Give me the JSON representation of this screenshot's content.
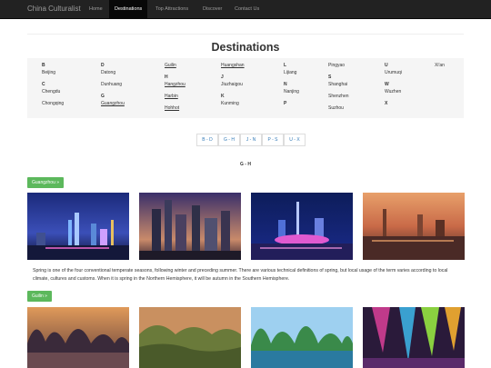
{
  "navbar": {
    "brand": "China Culturalist",
    "items": [
      {
        "label": "Home"
      },
      {
        "label": "Destinations",
        "active": true
      },
      {
        "label": "Top Attractions"
      },
      {
        "label": "Discover"
      },
      {
        "label": "Contact Us"
      }
    ]
  },
  "page_title": "Destinations",
  "index": {
    "b_letter": "B",
    "beijing": "Beijing",
    "c_letter": "C",
    "chengdu": "Chengdu",
    "chongqing": "Chongqing",
    "d_letter": "D",
    "datong": "Datong",
    "dunhuang": "Dunhuang",
    "g_letter": "G",
    "guangzhou": "Guangzhou",
    "guilin": "Guilin",
    "h_letter": "H",
    "hangzhou": "Hangzhou",
    "harbin": "Harbin",
    "hohhot": "Hohhot",
    "huangshan": "Huangshan",
    "j_letter": "J",
    "jiuzhaigou": "Jiuzhaigou",
    "k_letter": "K",
    "kunming": "Kunming",
    "l_letter": "L",
    "lijiang": "Lijiang",
    "n_letter": "N",
    "nanjing": "Nanjing",
    "p_letter": "P",
    "pingyao": "Pingyao",
    "s_letter": "S",
    "shanghai": "Shanghai",
    "shenzhen": "Shenzhen",
    "suzhou": "Suzhou",
    "u_letter": "U",
    "urumuqi": "Urumuqi",
    "w_letter": "W",
    "wuzhen": "Wuzhen",
    "x_letter": "X",
    "xian": "Xi'an"
  },
  "pagination": [
    "B - D",
    "G - H",
    "J - N",
    "P - S",
    "U - X"
  ],
  "section_heading": "G - H",
  "guangzhou_button": "Guangzhou »",
  "guilin_button": "Guilin »",
  "description": "Spring is one of the four conventional temperate seasons, following winter and preceding summer. There are various technical definitions of spring, but local usage of the term varies according to local climate, cultures and customs. When it is spring in the Northern Hemisphere, it will be autumn in the Southern Hemisphere.",
  "colors": {
    "navbar_bg": "#222222",
    "button_green": "#5cb85c",
    "link_blue": "#337ab7",
    "panel_bg": "#f5f5f5"
  }
}
